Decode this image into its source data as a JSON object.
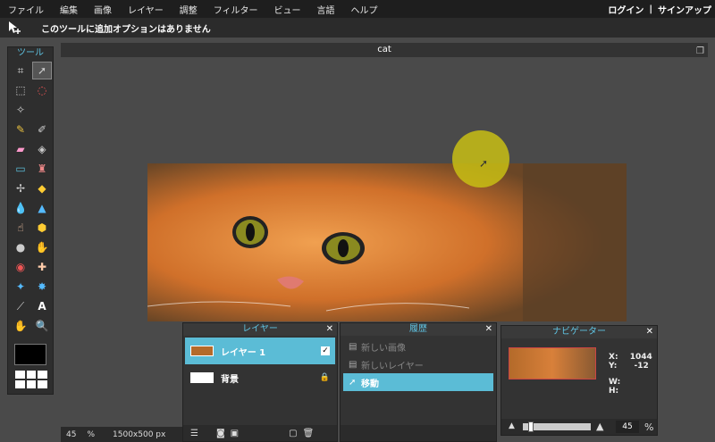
{
  "menu": {
    "items": [
      "ファイル",
      "編集",
      "画像",
      "レイヤー",
      "調整",
      "フィルター",
      "ビュー",
      "言語",
      "ヘルプ"
    ],
    "login": "ログイン",
    "separator": "|",
    "signup": "サインアップ"
  },
  "options": {
    "message": "このツールに追加オプションはありません"
  },
  "toolbox": {
    "title": "ツール"
  },
  "document": {
    "title": "cat"
  },
  "layers": {
    "title": "レイヤー",
    "items": [
      {
        "name": "レイヤー 1",
        "selected": true
      },
      {
        "name": "背景",
        "selected": false
      }
    ]
  },
  "history": {
    "title": "履歴",
    "items": [
      {
        "label": "新しい画像",
        "selected": false
      },
      {
        "label": "新しいレイヤー",
        "selected": false
      },
      {
        "label": "移動",
        "selected": true
      }
    ]
  },
  "navigator": {
    "title": "ナビゲーター",
    "x_label": "X:",
    "x_value": "1044",
    "y_label": "Y:",
    "y_value": "-12",
    "w_label": "W:",
    "h_label": "H:",
    "zoom": "45",
    "zoom_unit": "%",
    "zoom_level": 0.45
  },
  "status": {
    "zoom": "45",
    "unit": "%",
    "size": "1500x500 px"
  },
  "colors": {
    "accent": "#5bbcd6",
    "highlight": "#c8be14"
  }
}
